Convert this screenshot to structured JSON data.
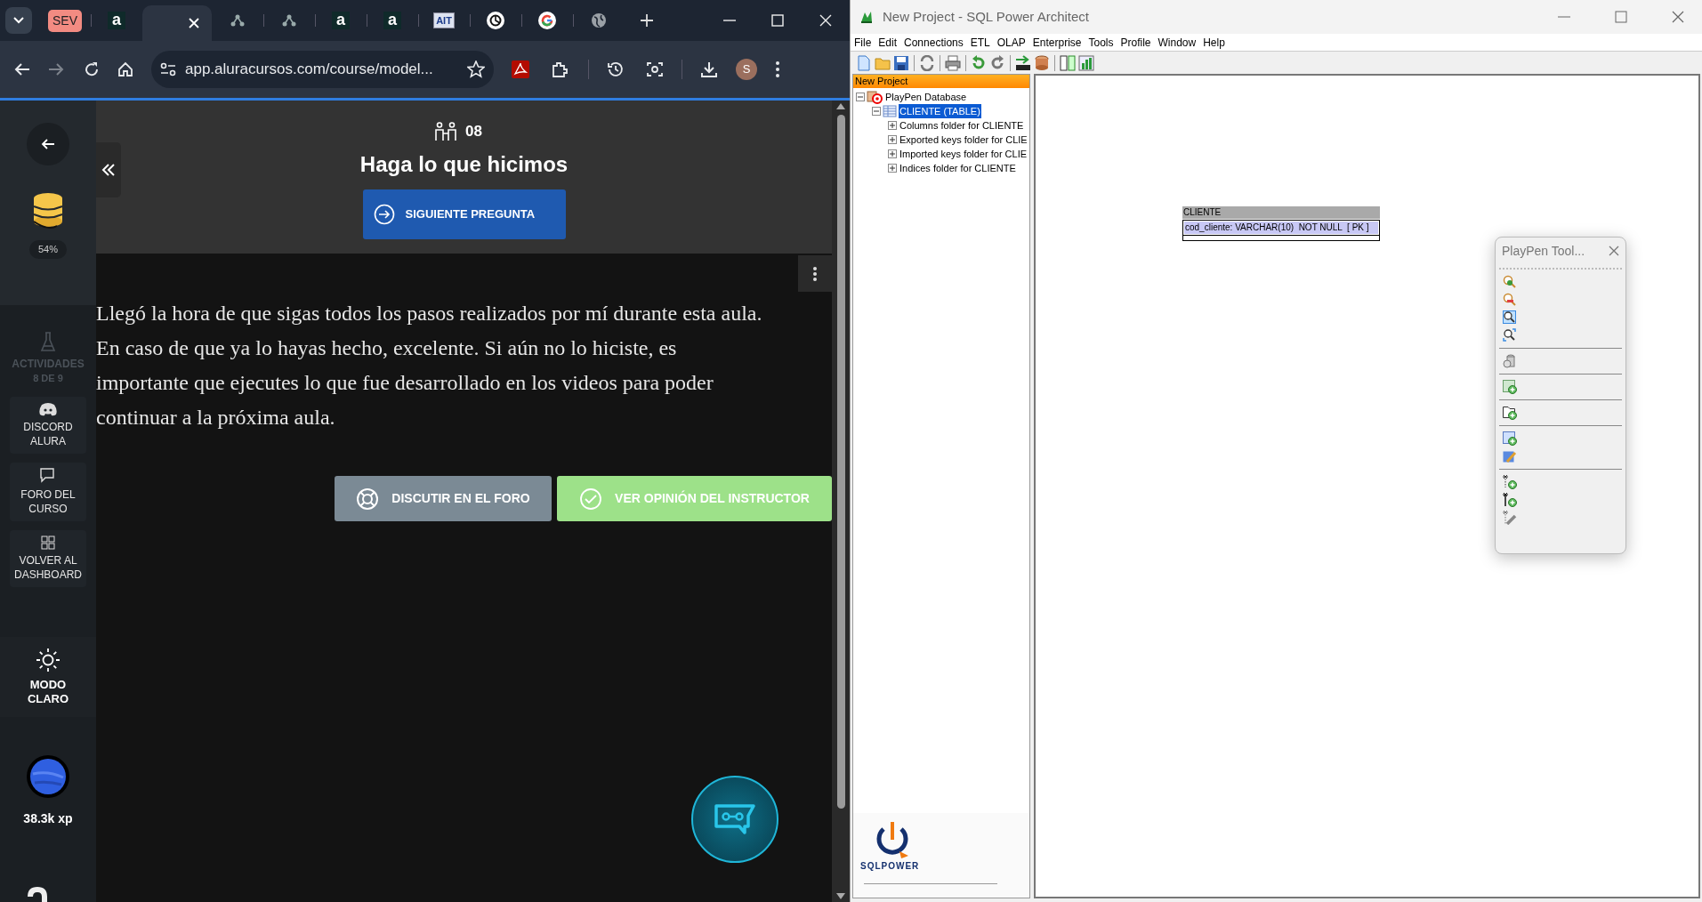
{
  "browser": {
    "tabs": [
      {
        "kind": "badge",
        "label": "SEV",
        "selected": false
      },
      {
        "kind": "letter",
        "label": "a",
        "selected": false
      },
      {
        "kind": "page",
        "selected": true
      },
      {
        "kind": "network",
        "selected": false
      },
      {
        "kind": "network",
        "selected": false
      },
      {
        "kind": "letter",
        "label": "a",
        "selected": false
      },
      {
        "kind": "letter",
        "label": "a",
        "selected": false
      },
      {
        "kind": "boxed",
        "label": "AIT",
        "selected": false
      },
      {
        "kind": "spiral",
        "selected": false
      },
      {
        "kind": "google",
        "selected": false
      },
      {
        "kind": "globe",
        "selected": false
      }
    ],
    "address": "app.aluracursos.com/course/model...",
    "profile_initial": "S"
  },
  "course": {
    "sidebar": {
      "progress": "54%",
      "items": [
        {
          "kind": "activities",
          "label": "ACTIVIDADES",
          "sub": "8 DE 9",
          "disabled": true
        },
        {
          "kind": "discord",
          "label": "DISCORD ALURA",
          "disabled": false
        },
        {
          "kind": "forum",
          "label": "FORO DEL CURSO",
          "disabled": false
        },
        {
          "kind": "dashboard",
          "label": "VOLVER AL DASHBOARD",
          "disabled": false
        }
      ],
      "theme": "MODO CLARO",
      "xp": "38.3k xp"
    },
    "task_number": "08",
    "title": "Haga lo que hicimos",
    "next_button": "SIGUIENTE PREGUNTA",
    "text": "Llegó la hora de que sigas todos los pasos realizados por mí durante esta aula. En caso de que ya lo hayas hecho, excelente. Si aún no lo hiciste, es importante que ejecutes lo que fue desarrollado en los videos para poder continuar a la próxima aula.",
    "buttons": [
      {
        "kind": "forum",
        "label": "DISCUTIR EN EL FORO"
      },
      {
        "kind": "answer",
        "label": "VER OPINIÓN DEL INSTRUCTOR"
      }
    ]
  },
  "sql": {
    "title": "New Project - SQL Power Architect",
    "menu": [
      "File",
      "Edit",
      "Connections",
      "ETL",
      "OLAP",
      "Enterprise",
      "Tools",
      "Profile",
      "Window",
      "Help"
    ],
    "tree_header": "New Project",
    "tree": [
      {
        "kind": "database",
        "label": "PlayPen Database",
        "expanded": true,
        "selected": false,
        "children": [
          {
            "kind": "table",
            "label": "CLIENTE (TABLE)",
            "expanded": true,
            "selected": true,
            "children": [
              {
                "label": "Columns folder for CLIENTE",
                "expanded": false,
                "selected": false
              },
              {
                "label": "Exported keys folder for CLIE",
                "expanded": false,
                "selected": false
              },
              {
                "label": "Imported keys folder for CLIE",
                "expanded": false,
                "selected": false
              },
              {
                "label": "Indices folder for CLIENTE",
                "expanded": false,
                "selected": false
              }
            ]
          }
        ]
      }
    ],
    "table": {
      "name": "CLIENTE",
      "columns": [
        {
          "label": "cod_cliente: VARCHAR(10)  NOT NULL  [ PK ]",
          "selected": true
        }
      ]
    },
    "logo_text": "SQLPOWER",
    "toolbox_title": "PlayPen Tool..."
  }
}
